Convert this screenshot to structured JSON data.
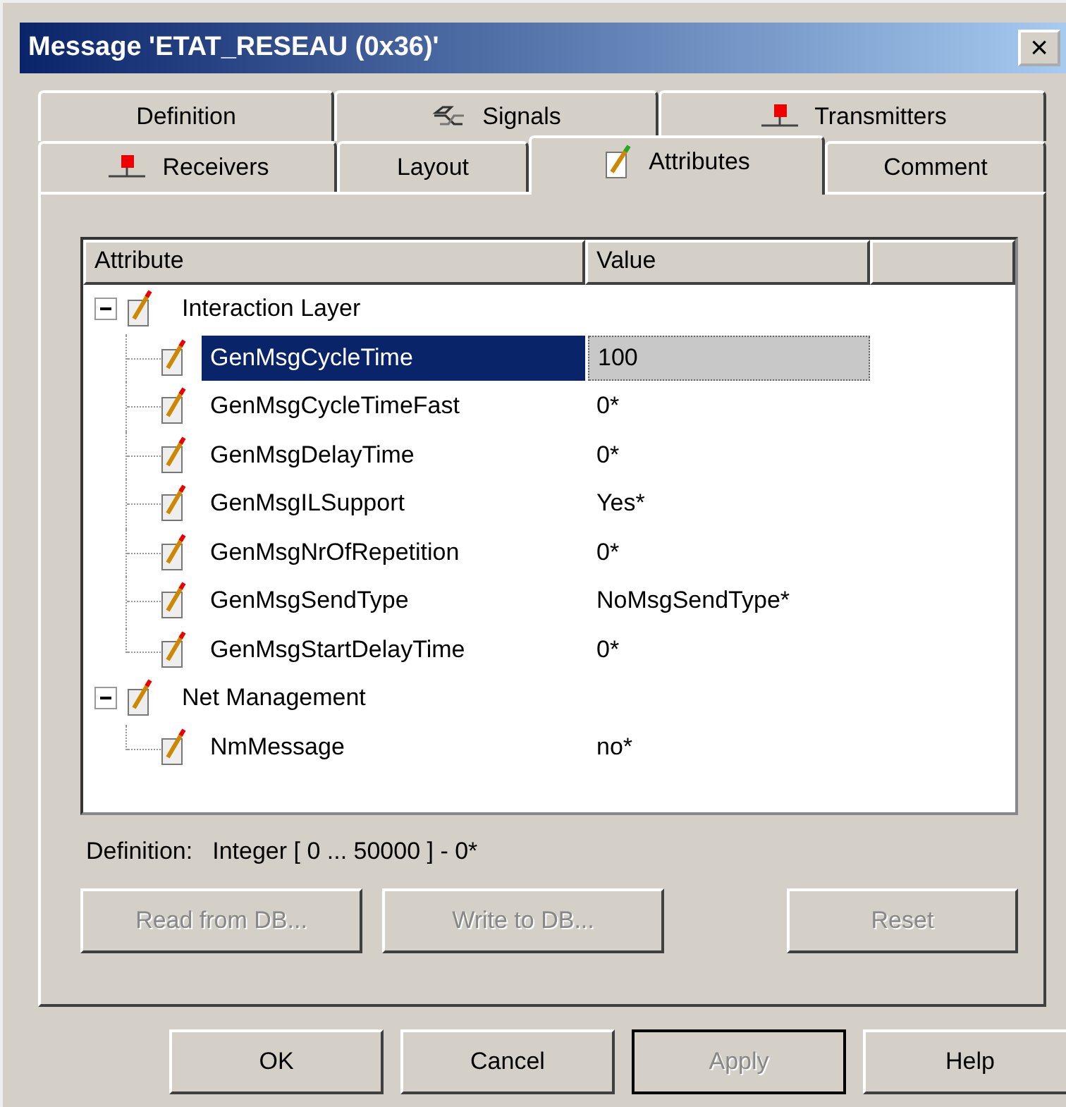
{
  "window": {
    "title": "Message 'ETAT_RESEAU (0x36)'",
    "close": "×"
  },
  "tab_rows": [
    [
      {
        "label": "Definition",
        "kind": "plain",
        "selected": false
      },
      {
        "label": "Signals",
        "kind": "signal",
        "selected": false
      },
      {
        "label": "Transmitters",
        "kind": "node",
        "selected": false
      }
    ],
    [
      {
        "label": "Receivers",
        "kind": "node",
        "selected": false
      },
      {
        "label": "Layout",
        "kind": "plain",
        "selected": false
      },
      {
        "label": "Attributes",
        "kind": "attribute",
        "selected": true
      },
      {
        "label": "Comment",
        "kind": "plain",
        "selected": false
      }
    ]
  ],
  "table": {
    "columns": [
      "Attribute",
      "Value"
    ],
    "rows": [
      {
        "name": "Interaction Layer",
        "expanded": true,
        "children": [
          {
            "name": "GenMsgCycleTime",
            "value": "100",
            "selected": true
          },
          {
            "name": "GenMsgCycleTimeFast",
            "value": "0*",
            "selected": false
          },
          {
            "name": "GenMsgDelayTime",
            "value": "0*",
            "selected": false
          },
          {
            "name": "GenMsgILSupport",
            "value": "Yes*",
            "selected": false
          },
          {
            "name": "GenMsgNrOfRepetition",
            "value": "0*",
            "selected": false
          },
          {
            "name": "GenMsgSendType",
            "value": "NoMsgSendType*",
            "selected": false
          },
          {
            "name": "GenMsgStartDelayTime",
            "value": "0*",
            "selected": false
          }
        ]
      },
      {
        "name": "Net Management",
        "expanded": true,
        "children": [
          {
            "name": "NmMessage",
            "value": "no*",
            "selected": false
          }
        ]
      }
    ]
  },
  "definition": {
    "label": "Definition:",
    "value": "Integer [ 0 ... 50000 ] - 0*"
  },
  "panel_buttons": [
    {
      "label": "Read from DB...",
      "disabled": true
    },
    {
      "label": "Write to DB...",
      "disabled": true
    },
    {
      "label": "Reset",
      "disabled": true
    }
  ],
  "dialog_buttons": [
    {
      "label": "OK",
      "disabled": false,
      "default": false
    },
    {
      "label": "Cancel",
      "disabled": false,
      "default": false
    },
    {
      "label": "Apply",
      "disabled": true,
      "default": true
    },
    {
      "label": "Help",
      "disabled": false,
      "default": false
    }
  ]
}
